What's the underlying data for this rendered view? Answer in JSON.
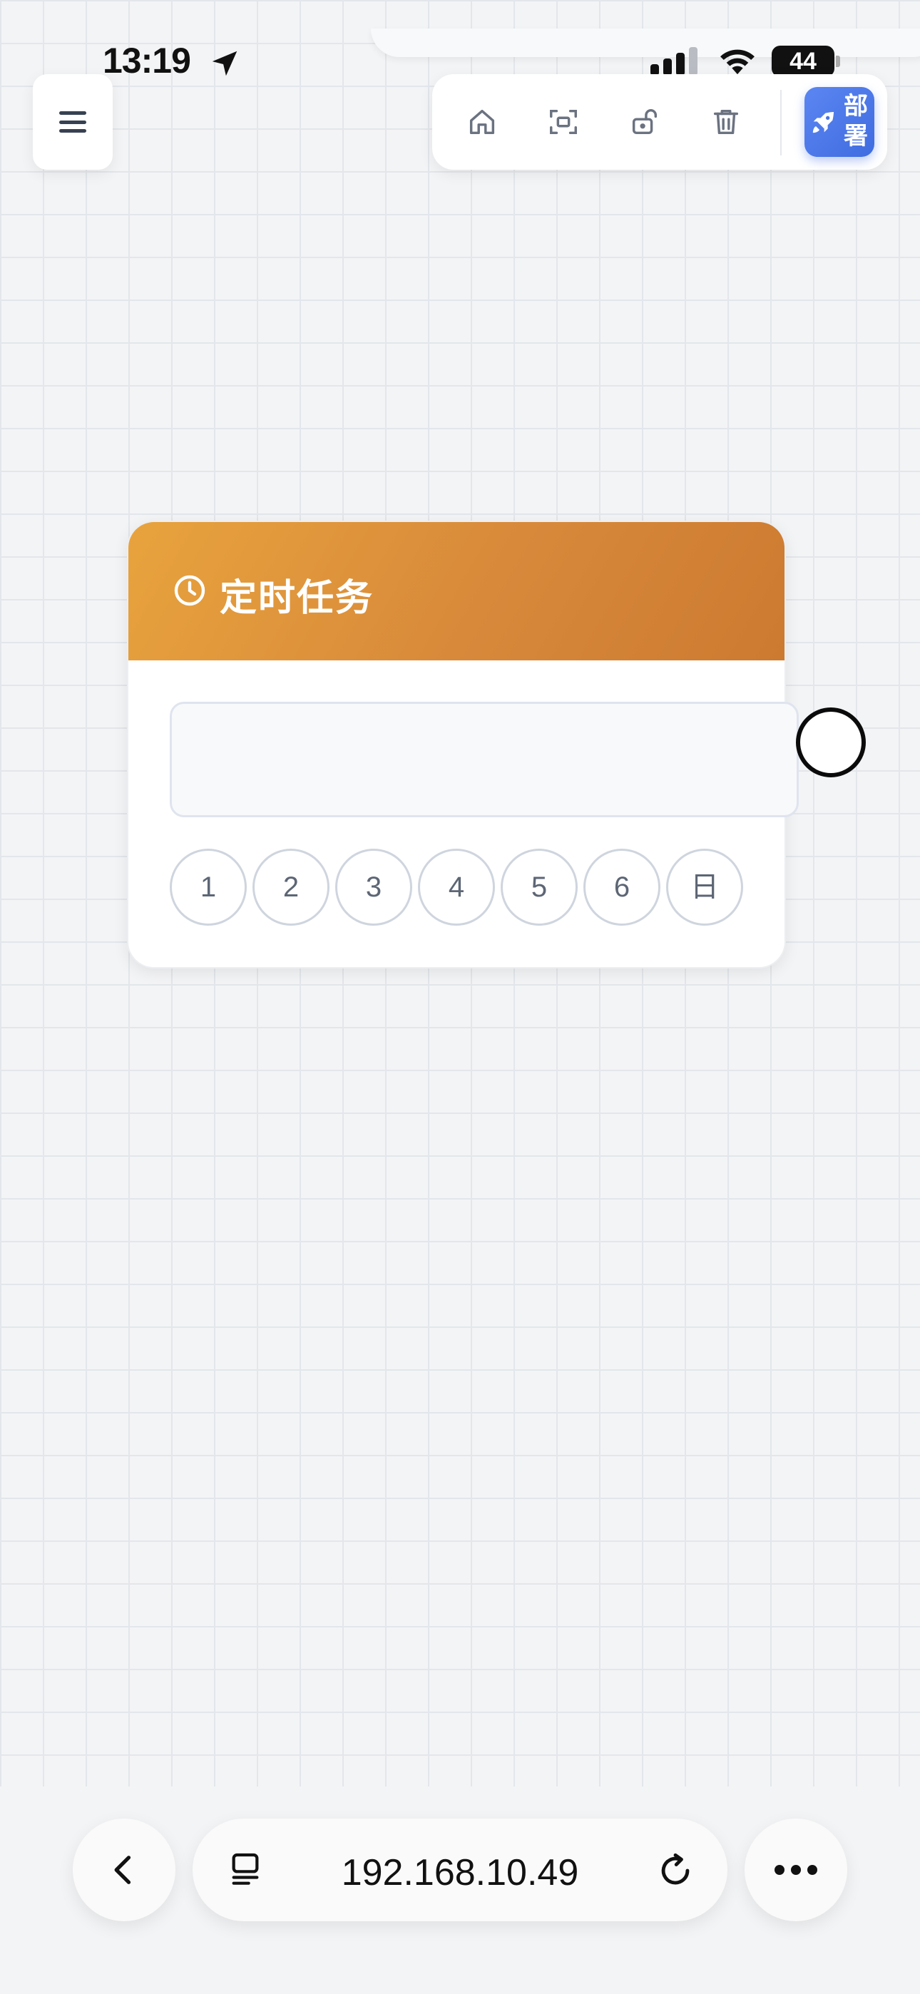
{
  "status_bar": {
    "time": "13:19",
    "battery": "44",
    "icons": [
      "location-arrow-icon",
      "cellular-signal-icon",
      "wifi-icon",
      "battery-icon"
    ]
  },
  "toolbar": {
    "menu_icon": "hamburger-menu-icon",
    "buttons": [
      "home-icon",
      "fit-view-icon",
      "unlock-icon",
      "trash-icon"
    ],
    "deploy_label": "部署",
    "deploy_icon": "rocket-icon"
  },
  "node": {
    "title": "定时任务",
    "icon": "clock-icon",
    "cron_value": "",
    "cron_placeholder": "",
    "days": [
      "1",
      "2",
      "3",
      "4",
      "5",
      "6",
      "日"
    ],
    "header_color_start": "#e8a33d",
    "header_color_end": "#cc7a30"
  },
  "browser": {
    "url": "192.168.10.49",
    "icons": [
      "back-chevron-icon",
      "tabs-icon",
      "reload-icon",
      "more-dots-icon"
    ]
  }
}
